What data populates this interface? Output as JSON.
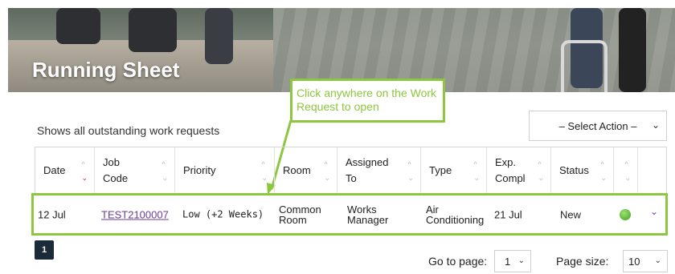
{
  "banner": {
    "title": "Running Sheet"
  },
  "callout": {
    "text": "Click anywhere on the Work Request to open"
  },
  "subtitle": "Shows all outstanding work requests",
  "action_select": {
    "value": "– Select Action –"
  },
  "table": {
    "columns": [
      {
        "label": "Date",
        "sorted": "desc"
      },
      {
        "label": "Job Code"
      },
      {
        "label": "Priority"
      },
      {
        "label": "Room"
      },
      {
        "label": "Assigned To"
      },
      {
        "label": "Type"
      },
      {
        "label": "Exp. Compl"
      },
      {
        "label": "Status"
      },
      {
        "label": ""
      }
    ],
    "rows": [
      {
        "date": "12 Jul",
        "job_code": "TEST2100007",
        "priority": "Low (+2 Weeks)",
        "room": "Common Room",
        "assigned_to": "Works Manager",
        "type": "Air Conditioning",
        "exp_compl": "21 Jul",
        "status": "New",
        "indicator_color": "#4caf30"
      }
    ]
  },
  "pagination": {
    "current_page": "1",
    "go_to_label": "Go to page:",
    "go_to_value": "1",
    "page_size_label": "Page size:",
    "page_size_value": "10"
  },
  "colors": {
    "accent_green": "#8dc63f",
    "link_purple": "#6a3d91",
    "sort_red": "#c0281c"
  }
}
